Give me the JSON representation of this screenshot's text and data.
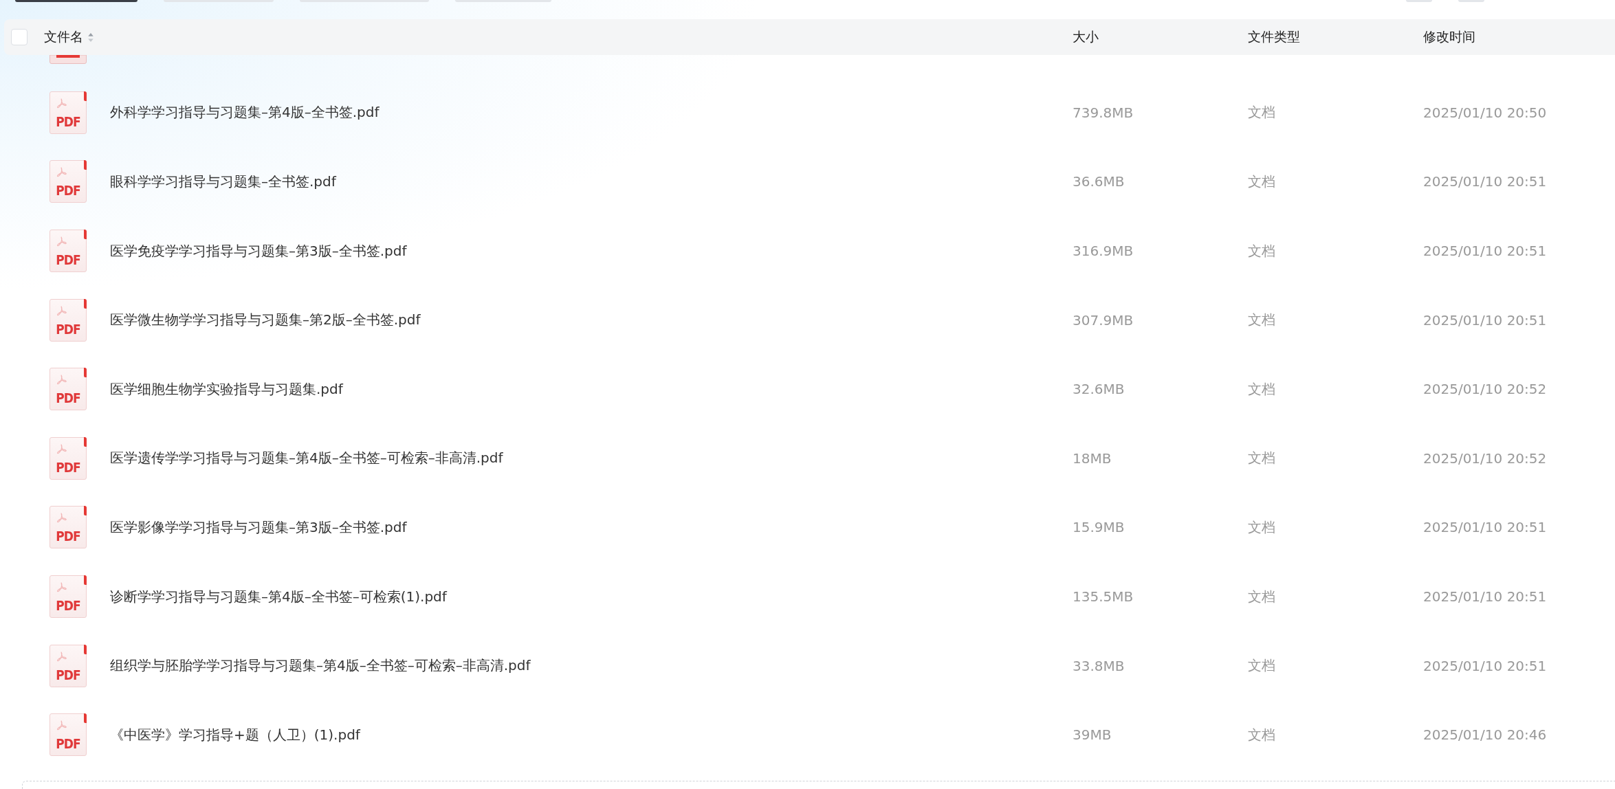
{
  "table": {
    "header": {
      "checked": false,
      "columns": [
        {
          "kind": "name",
          "label": "文件名"
        },
        {
          "kind": "size",
          "label": "大小"
        },
        {
          "kind": "type",
          "label": "文件类型"
        },
        {
          "kind": "time",
          "label": "修改时间"
        }
      ]
    },
    "rows": [
      {
        "icon_label": "PDF",
        "name": "外科学学习指导与习题集–第4版–全书签.pdf",
        "size": "739.8MB",
        "type": "文档",
        "modified": "2025/01/10 20:50"
      },
      {
        "icon_label": "PDF",
        "name": "眼科学学习指导与习题集–全书签.pdf",
        "size": "36.6MB",
        "type": "文档",
        "modified": "2025/01/10 20:51"
      },
      {
        "icon_label": "PDF",
        "name": "医学免疫学学习指导与习题集–第3版–全书签.pdf",
        "size": "316.9MB",
        "type": "文档",
        "modified": "2025/01/10 20:51"
      },
      {
        "icon_label": "PDF",
        "name": "医学微生物学学习指导与习题集–第2版–全书签.pdf",
        "size": "307.9MB",
        "type": "文档",
        "modified": "2025/01/10 20:51"
      },
      {
        "icon_label": "PDF",
        "name": "医学细胞生物学实验指导与习题集.pdf",
        "size": "32.6MB",
        "type": "文档",
        "modified": "2025/01/10 20:52"
      },
      {
        "icon_label": "PDF",
        "name": "医学遗传学学习指导与习题集–第4版–全书签–可检索–非高清.pdf",
        "size": "18MB",
        "type": "文档",
        "modified": "2025/01/10 20:52"
      },
      {
        "icon_label": "PDF",
        "name": "医学影像学学习指导与习题集–第3版–全书签.pdf",
        "size": "15.9MB",
        "type": "文档",
        "modified": "2025/01/10 20:51"
      },
      {
        "icon_label": "PDF",
        "name": "诊断学学习指导与习题集–第4版–全书签–可检索(1).pdf",
        "size": "135.5MB",
        "type": "文档",
        "modified": "2025/01/10 20:51"
      },
      {
        "icon_label": "PDF",
        "name": "组织学与胚胎学学习指导与习题集–第4版–全书签–可检索–非高清.pdf",
        "size": "33.8MB",
        "type": "文档",
        "modified": "2025/01/10 20:51"
      },
      {
        "icon_label": "PDF",
        "name": "《中医学》学习指导+题（人卫）(1).pdf",
        "size": "39MB",
        "type": "文档",
        "modified": "2025/01/10 20:46"
      }
    ]
  }
}
